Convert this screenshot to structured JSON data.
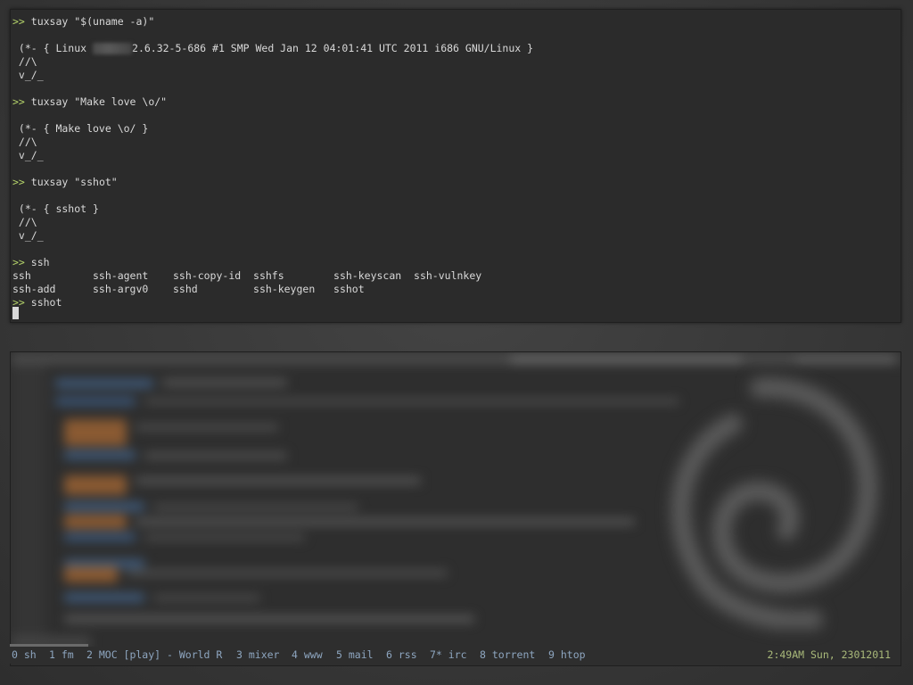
{
  "terminal": {
    "prompt": ">>",
    "lines": [
      {
        "kind": "cmd",
        "text": " tuxsay \"$(uname -a)\""
      },
      {
        "kind": "out",
        "text": " (*- { Linux ",
        "tail": "2.6.32-5-686 #1 SMP Wed Jan 12 04:01:41 UTC 2011 i686 GNU/Linux }"
      },
      {
        "kind": "out",
        "text": " //\\"
      },
      {
        "kind": "out",
        "text": " v_/_"
      },
      {
        "kind": "cmd",
        "text": " tuxsay \"Make love \\o/\""
      },
      {
        "kind": "out",
        "text": " (*- { Make love \\o/ }"
      },
      {
        "kind": "out",
        "text": " //\\"
      },
      {
        "kind": "out",
        "text": " v_/_"
      },
      {
        "kind": "cmd",
        "text": " tuxsay \"sshot\""
      },
      {
        "kind": "out",
        "text": " (*- { sshot }"
      },
      {
        "kind": "out",
        "text": " //\\"
      },
      {
        "kind": "out",
        "text": " v_/_"
      },
      {
        "kind": "cmd",
        "text": " ssh"
      },
      {
        "kind": "out",
        "text": "ssh          ssh-agent    ssh-copy-id  sshfs        ssh-keyscan  ssh-vulnkey"
      },
      {
        "kind": "out",
        "text": "ssh-add      ssh-argv0    sshd         ssh-keygen   sshot"
      },
      {
        "kind": "cmd",
        "text": " sshot"
      }
    ]
  },
  "statusbar": {
    "windows": [
      {
        "label": "0 sh"
      },
      {
        "label": "1 fm"
      },
      {
        "label": "2 MOC [play] - World R"
      },
      {
        "label": "3 mixer"
      },
      {
        "label": "4 www"
      },
      {
        "label": "5 mail"
      },
      {
        "label": "6 rss"
      },
      {
        "label": "7* irc"
      },
      {
        "label": "8 torrent"
      },
      {
        "label": "9 htop"
      }
    ],
    "clock": "2:49AM Sun, 23012011"
  },
  "colors": {
    "prompt": "#b5d46a",
    "text": "#d9d9d9",
    "status_windows": "#8ea6c0",
    "clock": "#a9b97a"
  }
}
